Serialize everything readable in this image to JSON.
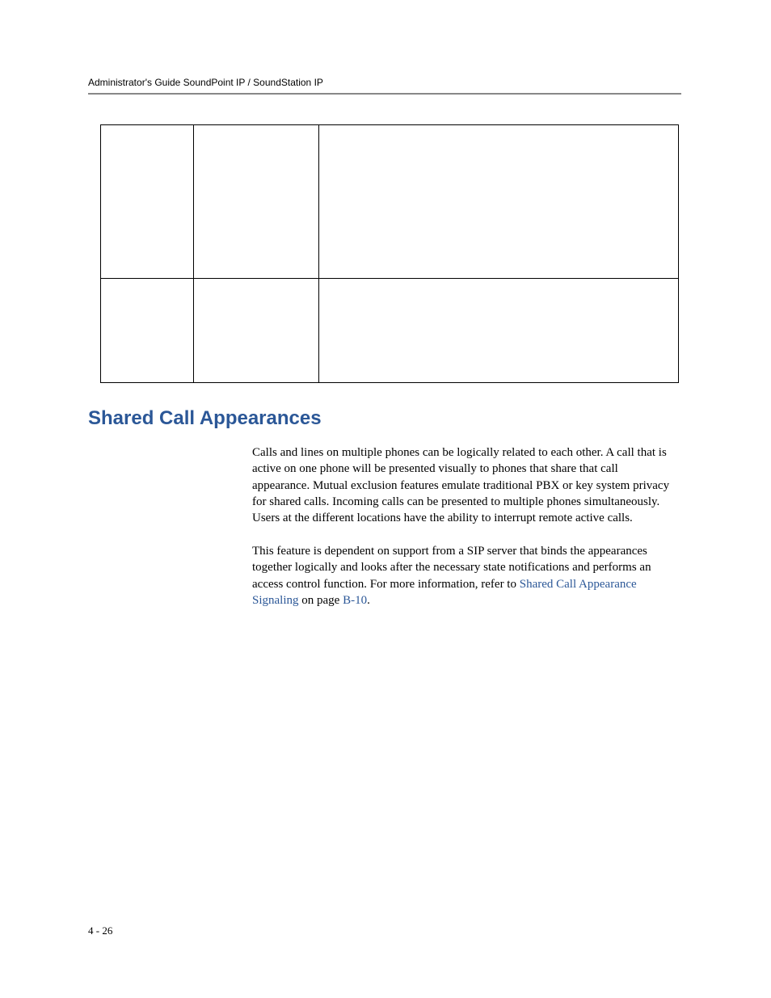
{
  "header": {
    "title": "Administrator's Guide SoundPoint IP / SoundStation IP"
  },
  "section": {
    "heading": "Shared Call Appearances"
  },
  "paragraphs": {
    "p1": "Calls and lines on multiple phones can be logically related to each other. A call that is active on one phone will be presented visually to phones that share that call appearance. Mutual exclusion features emulate traditional PBX or key system privacy for shared calls. Incoming calls can be presented to multiple phones simultaneously. Users at the different locations have the ability to interrupt remote active calls.",
    "p2_prefix": "This feature is dependent on support from a SIP server that binds the appearances together logically and looks after the necessary state notifications and performs an access control function. For more information, refer to ",
    "p2_link1": "Shared Call Appearance Signaling",
    "p2_mid": " on page ",
    "p2_link2": "B-10",
    "p2_suffix": "."
  },
  "footer": {
    "pagenum": "4 - 26"
  }
}
